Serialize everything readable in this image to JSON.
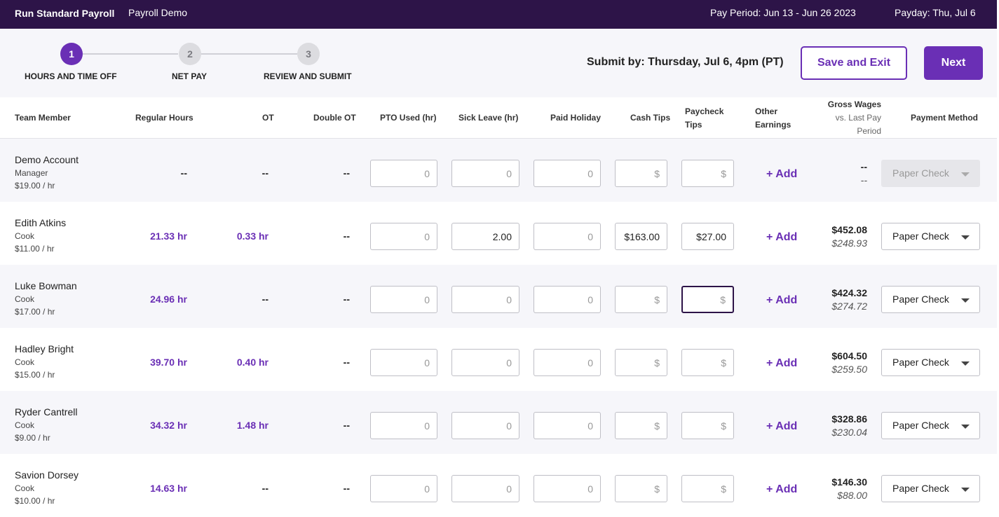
{
  "topbar": {
    "title": "Run Standard Payroll",
    "company": "Payroll Demo",
    "pay_period": "Pay Period: Jun 13 - Jun 26 2023",
    "payday": "Payday: Thu, Jul 6"
  },
  "steps": [
    {
      "number": "1",
      "label": "HOURS AND TIME OFF",
      "active": true
    },
    {
      "number": "2",
      "label": "NET PAY",
      "active": false
    },
    {
      "number": "3",
      "label": "REVIEW AND SUBMIT",
      "active": false
    }
  ],
  "submit_by": "Submit by: Thursday, Jul 6, 4pm (PT)",
  "actions": {
    "save_exit": "Save and Exit",
    "next": "Next"
  },
  "columns": {
    "team_member": "Team Member",
    "regular_hours": "Regular Hours",
    "ot": "OT",
    "double_ot": "Double OT",
    "pto": "PTO Used (hr)",
    "sick": "Sick Leave (hr)",
    "holiday": "Paid Holiday",
    "cash_tips": "Cash Tips",
    "paycheck_tips_1": "Paycheck",
    "paycheck_tips_2": "Tips",
    "other_1": "Other",
    "other_2": "Earnings",
    "gross_1": "Gross Wages",
    "gross_2": "vs. Last Pay",
    "gross_3": "Period",
    "payment": "Payment Method"
  },
  "placeholders": {
    "hours": "0",
    "money": "$"
  },
  "add_label": "+ Add",
  "rows": [
    {
      "name": "Demo Account",
      "role": "Manager",
      "rate": "$19.00 / hr",
      "regular": "--",
      "ot": "--",
      "double_ot": "--",
      "pto": "",
      "sick": "",
      "holiday": "",
      "cash_tips": "",
      "paycheck_tips": "",
      "gross": "--",
      "prev": "--",
      "payment": "Paper Check",
      "payment_disabled": true
    },
    {
      "name": "Edith Atkins",
      "role": "Cook",
      "rate": "$11.00 / hr",
      "regular": "21.33 hr",
      "ot": "0.33 hr",
      "double_ot": "--",
      "pto": "",
      "sick": "2.00",
      "holiday": "",
      "cash_tips": "$163.00",
      "paycheck_tips": "$27.00",
      "gross": "$452.08",
      "prev": "$248.93",
      "payment": "Paper Check",
      "payment_disabled": false
    },
    {
      "name": "Luke Bowman",
      "role": "Cook",
      "rate": "$17.00 / hr",
      "regular": "24.96 hr",
      "ot": "--",
      "double_ot": "--",
      "pto": "",
      "sick": "",
      "holiday": "",
      "cash_tips": "",
      "paycheck_tips": "",
      "gross": "$424.32",
      "prev": "$274.72",
      "payment": "Paper Check",
      "payment_disabled": false
    },
    {
      "name": "Hadley Bright",
      "role": "Cook",
      "rate": "$15.00 / hr",
      "regular": "39.70 hr",
      "ot": "0.40 hr",
      "double_ot": "--",
      "pto": "",
      "sick": "",
      "holiday": "",
      "cash_tips": "",
      "paycheck_tips": "",
      "gross": "$604.50",
      "prev": "$259.50",
      "payment": "Paper Check",
      "payment_disabled": false
    },
    {
      "name": "Ryder Cantrell",
      "role": "Cook",
      "rate": "$9.00 / hr",
      "regular": "34.32 hr",
      "ot": "1.48 hr",
      "double_ot": "--",
      "pto": "",
      "sick": "",
      "holiday": "",
      "cash_tips": "",
      "paycheck_tips": "",
      "gross": "$328.86",
      "prev": "$230.04",
      "payment": "Paper Check",
      "payment_disabled": false
    },
    {
      "name": "Savion Dorsey",
      "role": "Cook",
      "rate": "$10.00 / hr",
      "regular": "14.63 hr",
      "ot": "--",
      "double_ot": "--",
      "pto": "",
      "sick": "",
      "holiday": "",
      "cash_tips": "",
      "paycheck_tips": "",
      "gross": "$146.30",
      "prev": "$88.00",
      "payment": "Paper Check",
      "payment_disabled": false
    }
  ]
}
